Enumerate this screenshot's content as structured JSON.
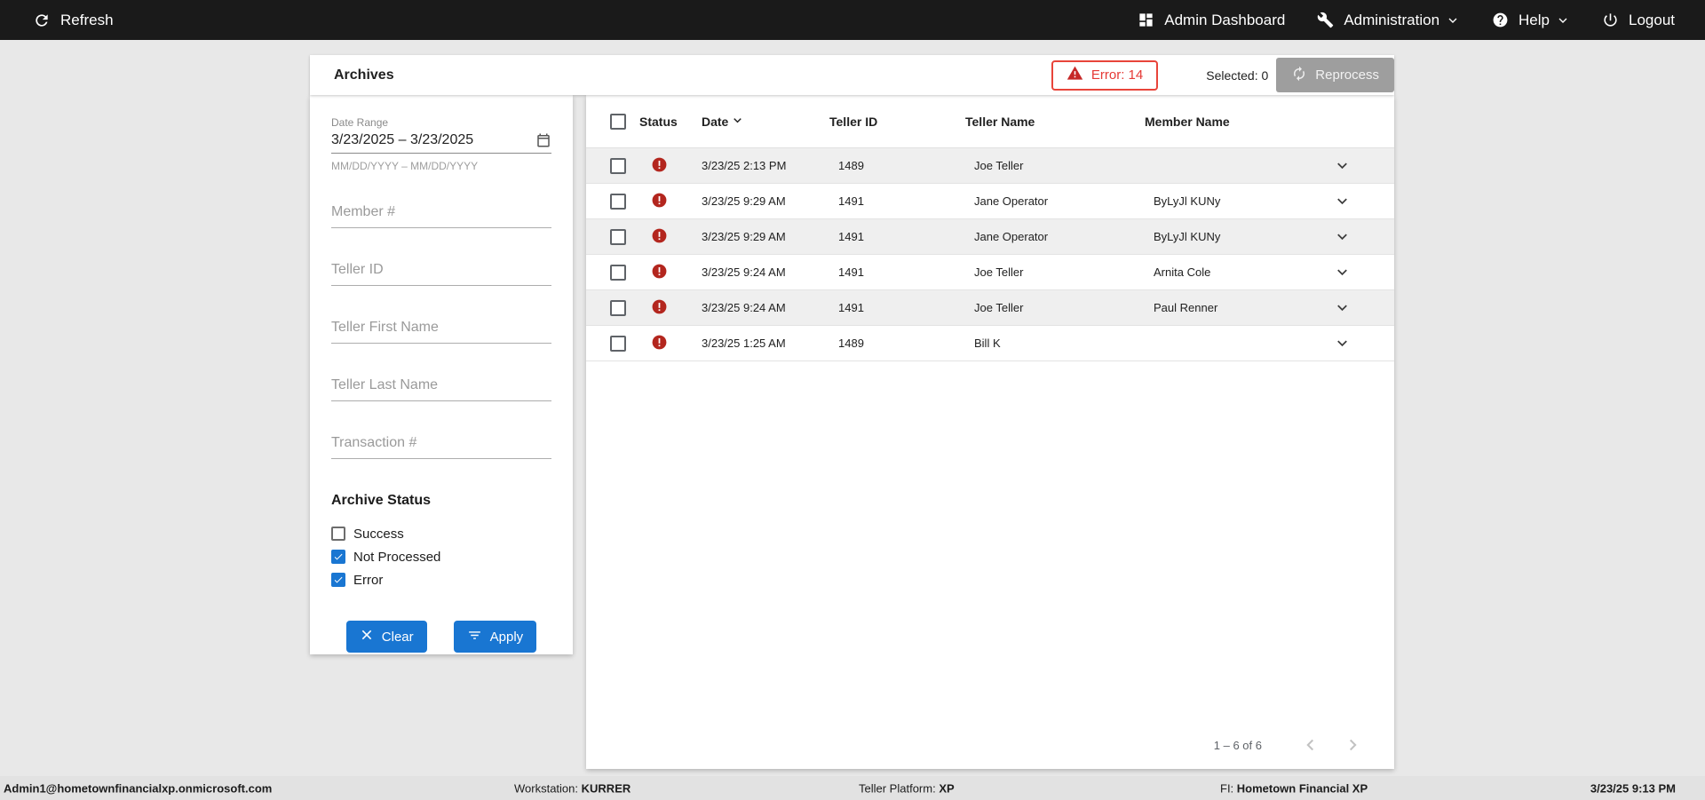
{
  "topbar": {
    "refresh_label": "Refresh",
    "admin_dashboard_label": "Admin Dashboard",
    "administration_label": "Administration",
    "help_label": "Help",
    "logout_label": "Logout"
  },
  "header": {
    "title": "Archives",
    "error_button_label": "Error: 14",
    "selected_label": "Selected: 0",
    "reprocess_label": "Reprocess"
  },
  "filters": {
    "date_range": {
      "label": "Date Range",
      "value": "3/23/2025 – 3/23/2025",
      "hint": "MM/DD/YYYY – MM/DD/YYYY"
    },
    "member_number_placeholder": "Member #",
    "teller_id_placeholder": "Teller ID",
    "teller_first_name_placeholder": "Teller First Name",
    "teller_last_name_placeholder": "Teller Last Name",
    "transaction_number_placeholder": "Transaction #",
    "archive_status": {
      "label": "Archive Status",
      "options": [
        {
          "label": "Success",
          "checked": false
        },
        {
          "label": "Not Processed",
          "checked": true
        },
        {
          "label": "Error",
          "checked": true
        }
      ]
    },
    "clear_label": "Clear",
    "apply_label": "Apply"
  },
  "table": {
    "columns": {
      "status": "Status",
      "date": "Date",
      "teller_id": "Teller ID",
      "teller_name": "Teller Name",
      "member_name": "Member Name"
    },
    "sort": {
      "column": "Date",
      "direction": "descending"
    },
    "rows": [
      {
        "status": "error",
        "date": "3/23/25 2:13 PM",
        "teller_id": "1489",
        "teller_name": "Joe Teller",
        "member_name": ""
      },
      {
        "status": "error",
        "date": "3/23/25 9:29 AM",
        "teller_id": "1491",
        "teller_name": "Jane Operator",
        "member_name": "ByLyJl KUNy"
      },
      {
        "status": "error",
        "date": "3/23/25 9:29 AM",
        "teller_id": "1491",
        "teller_name": "Jane Operator",
        "member_name": "ByLyJl KUNy"
      },
      {
        "status": "error",
        "date": "3/23/25 9:24 AM",
        "teller_id": "1491",
        "teller_name": "Joe Teller",
        "member_name": "Arnita Cole"
      },
      {
        "status": "error",
        "date": "3/23/25 9:24 AM",
        "teller_id": "1491",
        "teller_name": "Joe Teller",
        "member_name": "Paul Renner"
      },
      {
        "status": "error",
        "date": "3/23/25 1:25 AM",
        "teller_id": "1489",
        "teller_name": "Bill K",
        "member_name": ""
      }
    ],
    "pagination": {
      "range_label": "1 – 6 of 6"
    }
  },
  "statusbar": {
    "user": "Admin1@hometownfinancialxp.onmicrosoft.com",
    "workstation_label": "Workstation:",
    "workstation_value": "KURRER",
    "platform_label": "Teller Platform:",
    "platform_value": "XP",
    "fi_label": "FI:",
    "fi_value": "Hometown Financial XP",
    "datetime": "3/23/25 9:13 PM"
  },
  "colors": {
    "accent": "#1976d2",
    "error": "#b3261e",
    "error_border": "#e8443a",
    "topbar_bg": "#1a1a1a"
  }
}
